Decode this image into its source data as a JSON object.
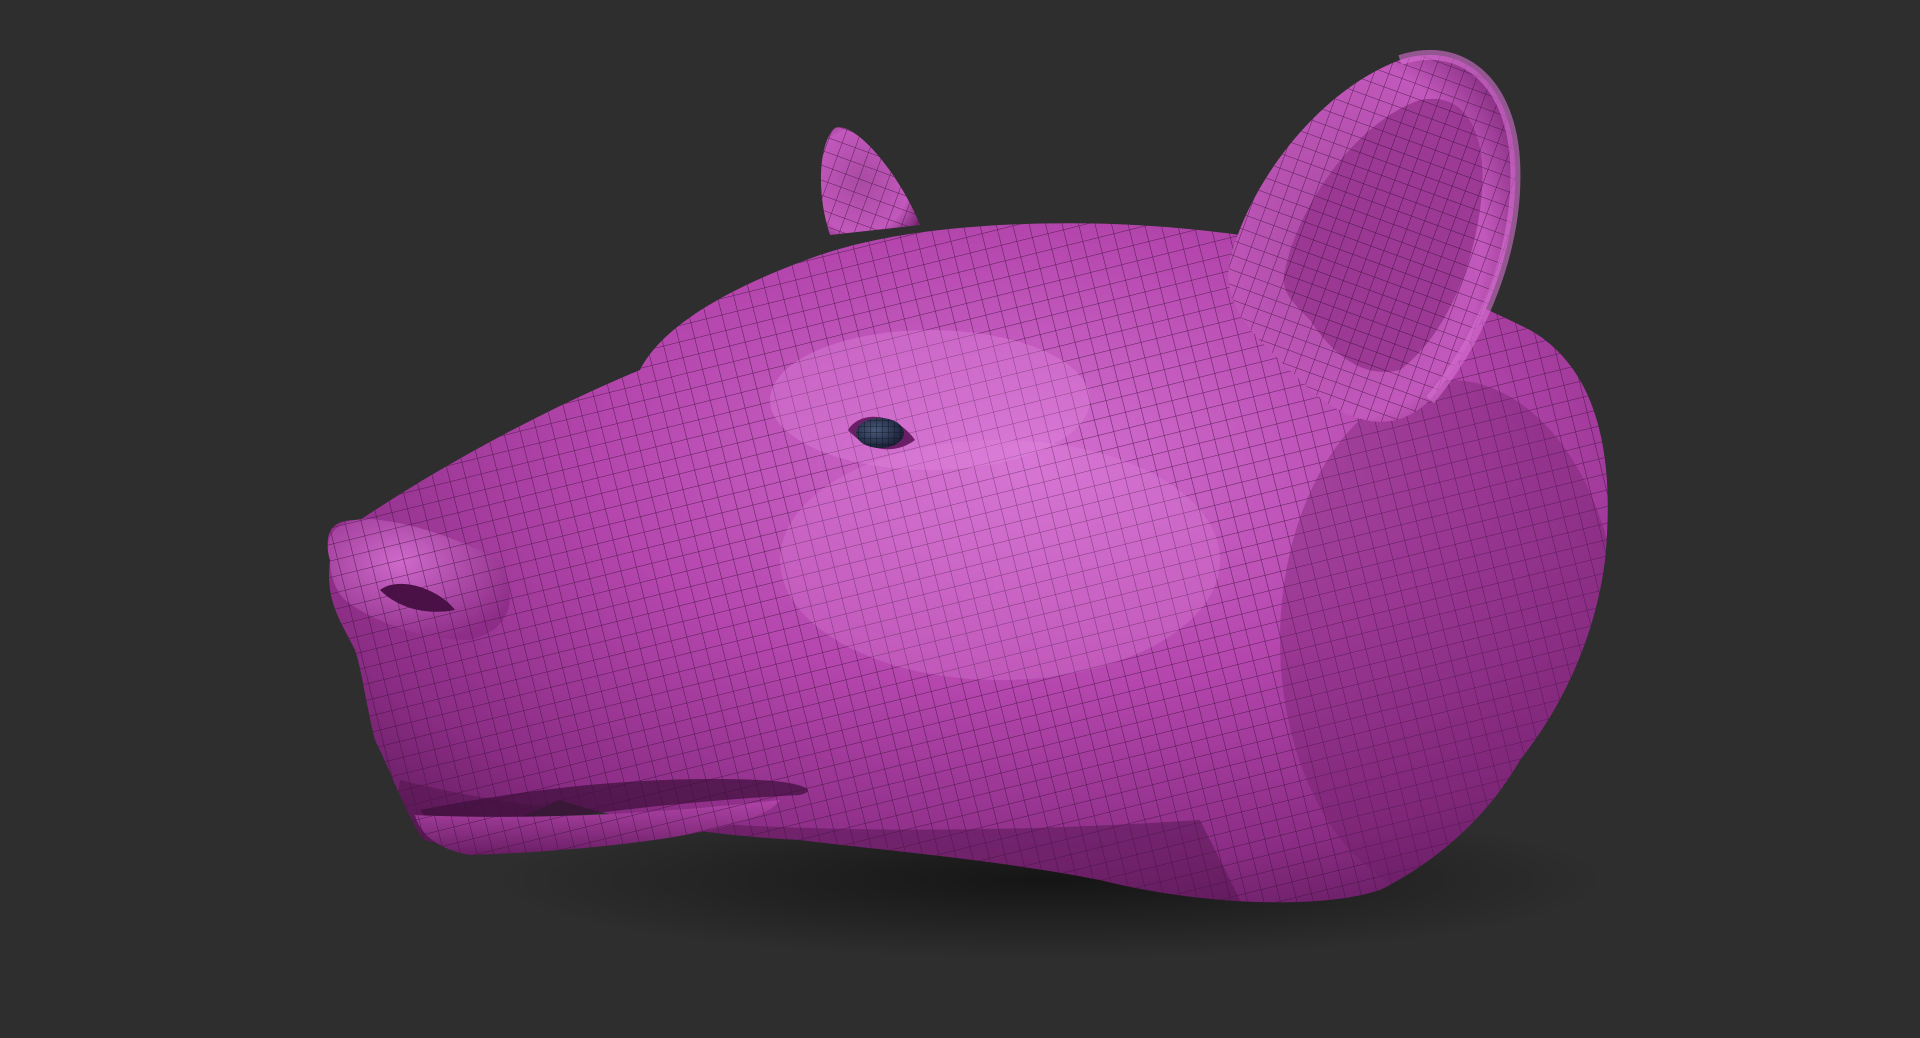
{
  "scene": {
    "background_color": "#2e2e2e",
    "model": "bear-head-wireframe",
    "material_colors": {
      "base": "#a8399f",
      "highlight": "#d670d2",
      "shadow": "#5e1a5a",
      "wire": "#3a0f37",
      "eye": "#2b3a5a"
    }
  }
}
